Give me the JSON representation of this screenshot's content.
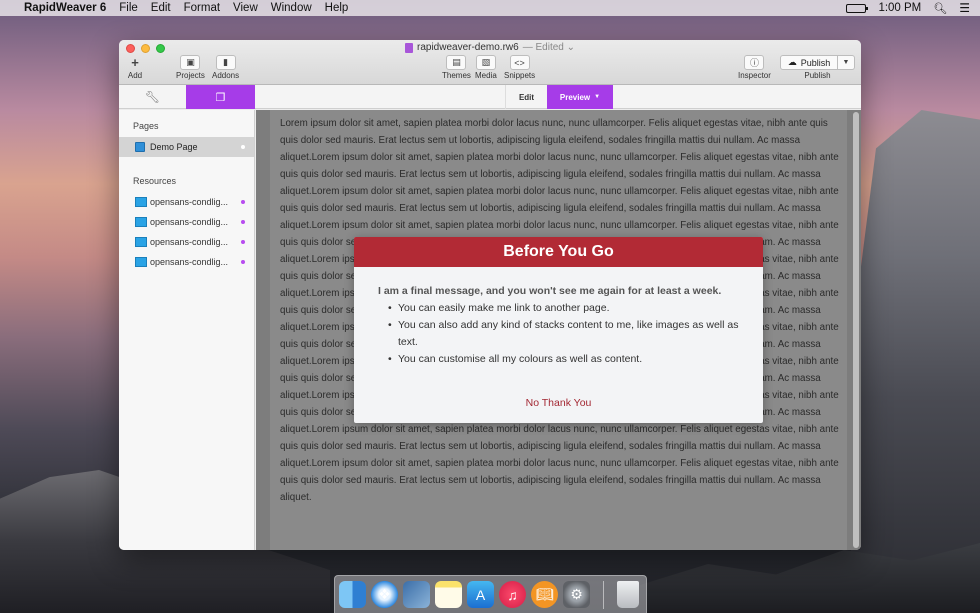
{
  "menubar": {
    "app_name": "RapidWeaver 6",
    "items": [
      "File",
      "Edit",
      "Format",
      "View",
      "Window",
      "Help"
    ],
    "clock": "1:00 PM",
    "battery_level": 0.9
  },
  "window": {
    "doc_title": "rapidweaver-demo.rw6",
    "doc_state": "Edited",
    "toolbar": {
      "add": "Add",
      "projects": "Projects",
      "addons": "Addons",
      "themes": "Themes",
      "media": "Media",
      "snippets": "Snippets",
      "inspector": "Inspector",
      "publish_button": "Publish",
      "publish_label": "Publish"
    },
    "tabs": {
      "edit": "Edit",
      "preview": "Preview"
    },
    "sidebar": {
      "pages_title": "Pages",
      "pages": [
        {
          "label": "Demo Page"
        }
      ],
      "resources_title": "Resources",
      "resources": [
        {
          "label": "opensans-condlig..."
        },
        {
          "label": "opensans-condlig..."
        },
        {
          "label": "opensans-condlig..."
        },
        {
          "label": "opensans-condlig..."
        }
      ]
    },
    "preview_text": "Lorem ipsum dolor sit amet, sapien platea morbi dolor lacus nunc, nunc ullamcorper. Felis aliquet egestas vitae, nibh ante quis quis dolor sed mauris. Erat lectus sem ut lobortis, adipiscing ligula eleifend, sodales fringilla mattis dui nullam. Ac massa aliquet.Lorem ipsum dolor sit amet, sapien platea morbi dolor lacus nunc, nunc ullamcorper. Felis aliquet egestas vitae, nibh ante quis quis dolor sed mauris. Erat lectus sem ut lobortis, adipiscing ligula eleifend, sodales fringilla mattis dui nullam. Ac massa aliquet.Lorem ipsum dolor sit amet, sapien platea morbi dolor lacus nunc, nunc ullamcorper. Felis aliquet egestas vitae, nibh ante quis quis dolor sed mauris. Erat lectus sem ut lobortis, adipiscing ligula eleifend, sodales fringilla mattis dui nullam. Ac massa aliquet.Lorem ipsum dolor sit amet, sapien platea morbi dolor lacus nunc, nunc ullamcorper. Felis aliquet egestas vitae, nibh ante quis quis dolor sed mauris. Erat lectus sem ut lobortis, adipiscing ligula eleifend, sodales fringilla mattis dui nullam. Ac massa aliquet.Lorem ipsum dolor sit amet, sapien platea morbi dolor lacus nunc, nunc ullamcorper. Felis aliquet egestas vitae, nibh ante quis quis dolor sed mauris. Erat lectus sem ut lobortis, adipiscing ligula eleifend, sodales fringilla mattis dui nullam. Ac massa aliquet.Lorem ipsum dolor sit amet, sapien platea morbi dolor lacus nunc, nunc ullamcorper. Felis aliquet egestas vitae, nibh ante quis quis dolor sed mauris. Erat lectus sem ut lobortis, adipiscing ligula eleifend, sodales fringilla mattis dui nullam. Ac massa aliquet.Lorem ipsum dolor sit amet, sapien platea morbi dolor lacus nunc, nunc ullamcorper. Felis aliquet egestas vitae, nibh ante quis quis dolor sed mauris. Erat lectus sem ut lobortis, adipiscing ligula eleifend, sodales fringilla mattis dui nullam. Ac massa aliquet.Lorem ipsum dolor sit amet, sapien platea morbi dolor lacus nunc, nunc ullamcorper. Felis aliquet egestas vitae, nibh ante quis quis dolor sed mauris. Erat lectus sem ut lobortis, adipiscing ligula eleifend, sodales fringilla mattis dui nullam. Ac massa aliquet.Lorem ipsum dolor sit amet, sapien platea morbi dolor lacus nunc, nunc ullamcorper. Felis aliquet egestas vitae, nibh ante quis quis dolor sed mauris. Erat lectus sem ut lobortis, adipiscing ligula eleifend, sodales fringilla mattis dui nullam. Ac massa aliquet.Lorem ipsum dolor sit amet, sapien platea morbi dolor lacus nunc, nunc ullamcorper. Felis aliquet egestas vitae, nibh ante quis quis dolor sed mauris. Erat lectus sem ut lobortis, adipiscing ligula eleifend, sodales fringilla mattis dui nullam. Ac massa aliquet.Lorem ipsum dolor sit amet, sapien platea morbi dolor lacus nunc, nunc ullamcorper. Felis aliquet egestas vitae, nibh ante quis quis dolor sed mauris. Erat lectus sem ut lobortis, adipiscing ligula eleifend, sodales fringilla mattis dui nullam. Ac massa aliquet."
  },
  "modal": {
    "title": "Before You Go",
    "intro": "I am a final message, and you won't see me again for at least a week.",
    "bullets": [
      "You can easily make me link to another page.",
      "You can also add any kind of stacks content to me, like images as well as text.",
      "You can customise all my colours as well as content."
    ],
    "dismiss": "No Thank You"
  },
  "colors": {
    "accent_purple": "#a63ce8",
    "modal_header": "#b22a35",
    "dismiss_link": "#a32833"
  },
  "dock": {
    "icons": [
      "finder-icon",
      "safari-icon",
      "preview-icon",
      "notes-icon",
      "app-store-icon",
      "itunes-icon",
      "ibooks-icon",
      "system-preferences-icon",
      "trash-icon"
    ]
  }
}
